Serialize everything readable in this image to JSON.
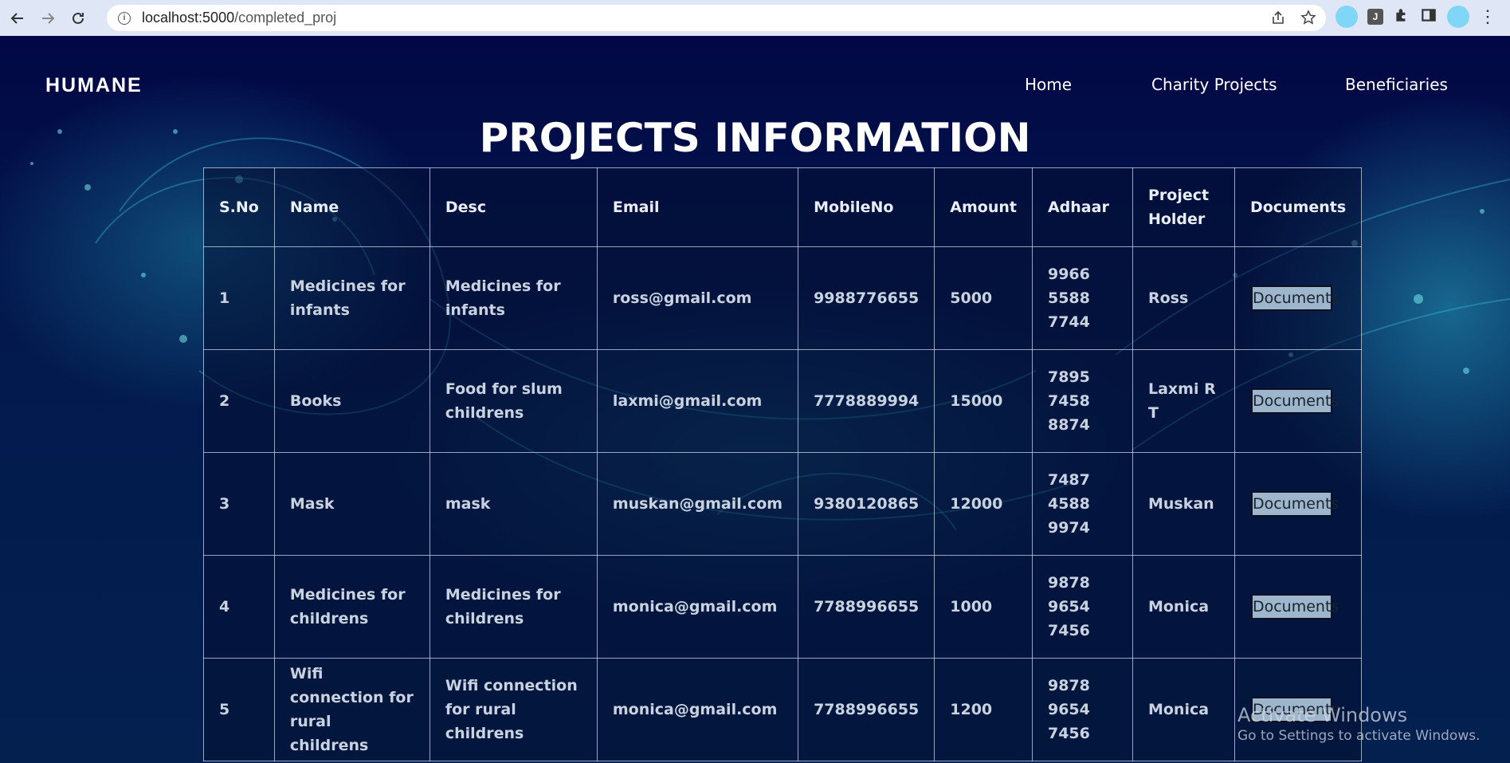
{
  "browser": {
    "url_host": "localhost:5000",
    "url_path": "/completed_proj",
    "extension_label": "J"
  },
  "nav": {
    "brand": "HUMANE",
    "links": [
      "Home",
      "Charity Projects",
      "Beneficiaries"
    ]
  },
  "page": {
    "title": "PROJECTS INFORMATION"
  },
  "table": {
    "headers": [
      "S.No",
      "Name",
      "Desc",
      "Email",
      "MobileNo",
      "Amount",
      "Adhaar",
      "Project Holder",
      "Documents"
    ],
    "rows": [
      {
        "sno": "1",
        "name": "Medicines for infants",
        "desc": "Medicines for infants",
        "email": "ross@gmail.com",
        "mobile": "9988776655",
        "amount": "5000",
        "adhaar": "9966 5588 7744",
        "holder": "Ross",
        "doc_label": "Documents"
      },
      {
        "sno": "2",
        "name": "Books",
        "desc": "Food for slum childrens",
        "email": "laxmi@gmail.com",
        "mobile": "7778889994",
        "amount": "15000",
        "adhaar": "7895 7458 8874",
        "holder": "Laxmi R T",
        "doc_label": "Documents"
      },
      {
        "sno": "3",
        "name": "Mask",
        "desc": "mask",
        "email": "muskan@gmail.com",
        "mobile": "9380120865",
        "amount": "12000",
        "adhaar": "7487 4588 9974",
        "holder": "Muskan",
        "doc_label": "Documents"
      },
      {
        "sno": "4",
        "name": "Medicines for childrens",
        "desc": "Medicines for childrens",
        "email": "monica@gmail.com",
        "mobile": "7788996655",
        "amount": "1000",
        "adhaar": "9878 9654 7456",
        "holder": "Monica",
        "doc_label": "Documents"
      },
      {
        "sno": "5",
        "name": "Wifi connection for rural childrens",
        "desc": "Wifi connection for rural childrens",
        "email": "monica@gmail.com",
        "mobile": "7788996655",
        "amount": "1200",
        "adhaar": "9878 9654 7456",
        "holder": "Monica",
        "doc_label": "Documents"
      }
    ]
  },
  "watermark": {
    "line1": "Activate Windows",
    "line2": "Go to Settings to activate Windows."
  },
  "colors": {
    "page_bg": "#000436",
    "accent_cyan": "#2fb6d0",
    "doc_button": "#9db6cc"
  }
}
